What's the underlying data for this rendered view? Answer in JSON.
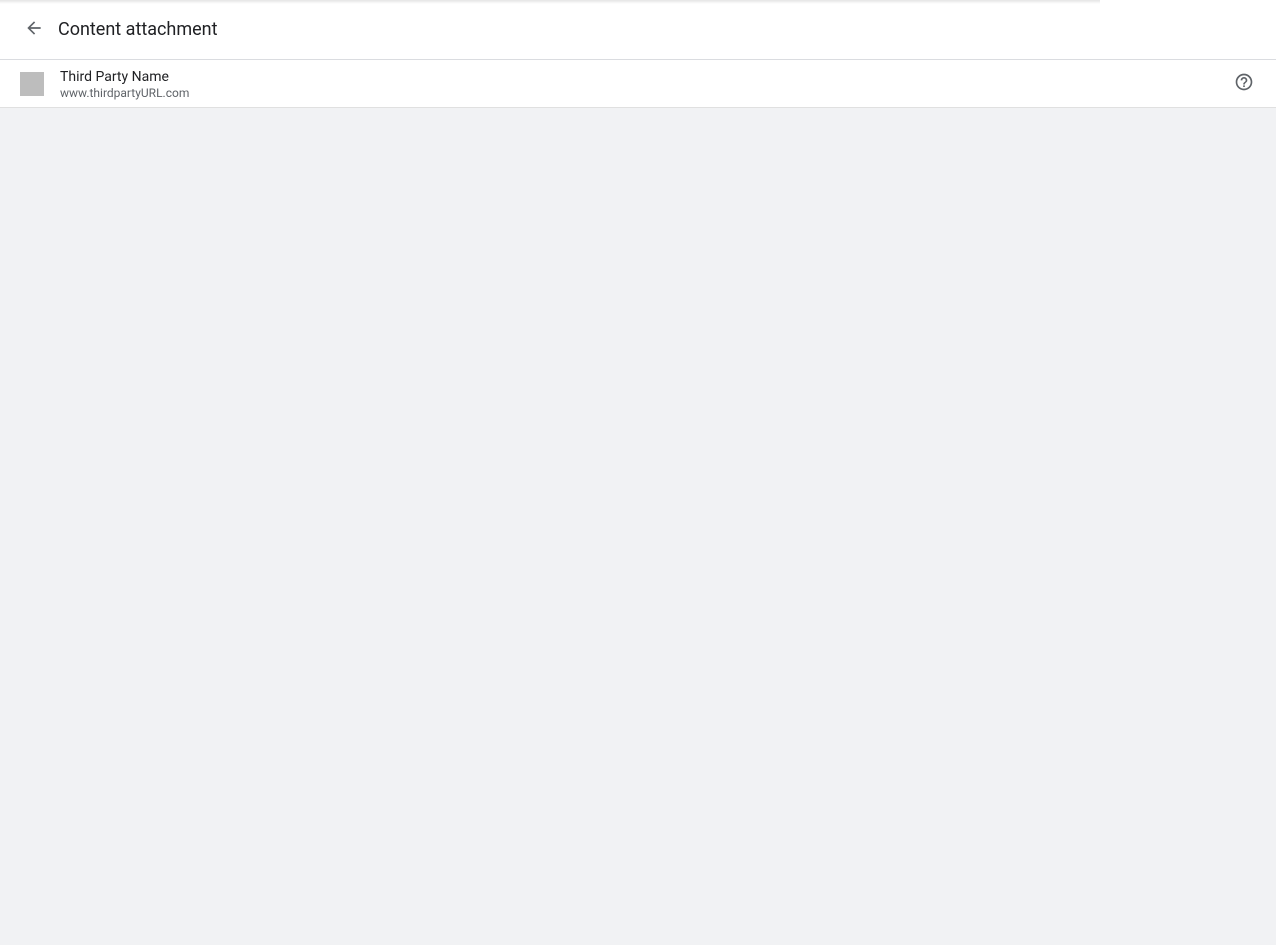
{
  "titlebar": {
    "page_title": "Content attachment"
  },
  "subheader": {
    "third_party_name": "Third Party Name",
    "third_party_url": "www.thirdpartyURL.com"
  }
}
